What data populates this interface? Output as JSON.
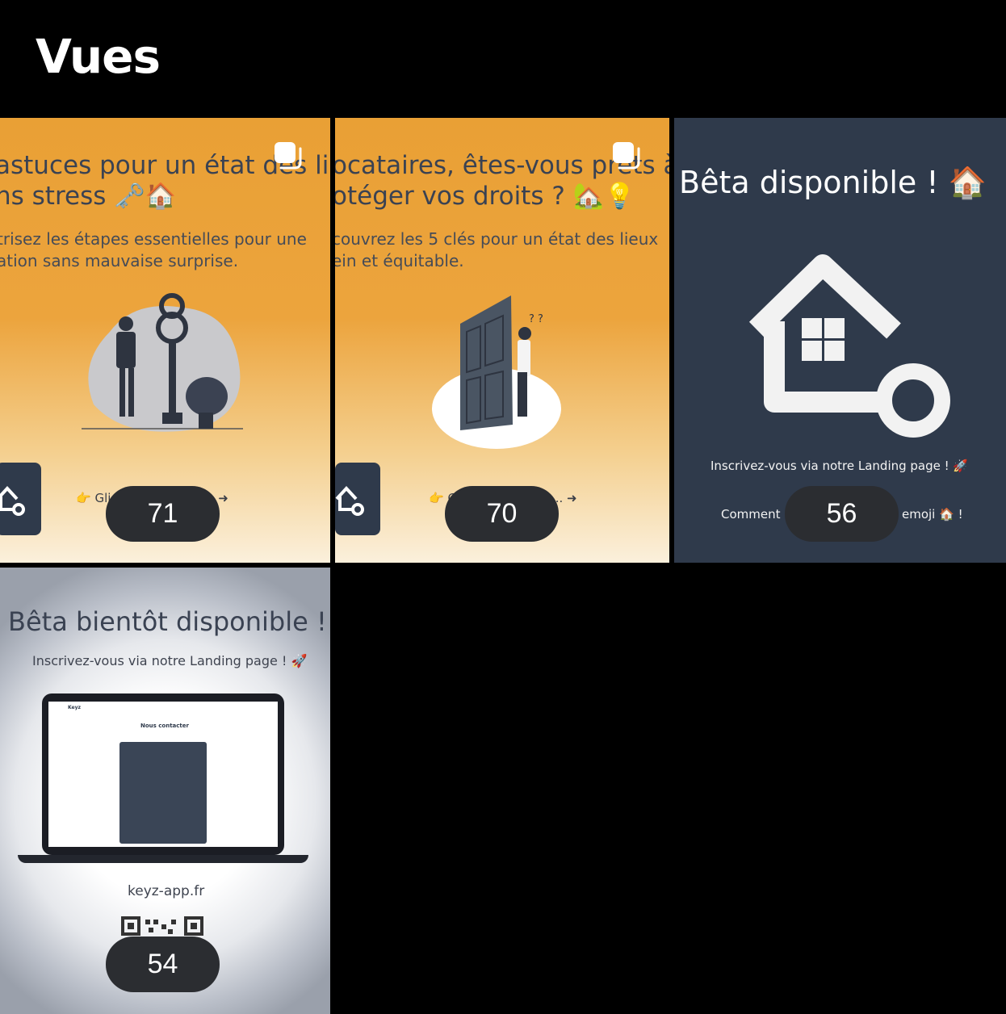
{
  "header": {
    "title": "Vues"
  },
  "tiles": [
    {
      "title_line1": "astuces pour un état des lie",
      "title_line2": "ns stress 🗝️🏠",
      "subtitle_line1": "trisez les étapes essentielles pour une",
      "subtitle_line2": "ation sans mauvaise surprise.",
      "swipe_text": "👉 Gli          rir ces astuces... ➜",
      "views": "71"
    },
    {
      "title_line1": "ocataires, êtes-vous prêts à",
      "title_line2": "otéger vos droits ? 🏡💡",
      "subtitle_line1": "couvrez les 5 clés pour un état des lieux",
      "subtitle_line2": "ein et équitable.",
      "swipe_text": "👉 G          aître vos droits... ➜",
      "views": "70"
    },
    {
      "title": "Bêta disponible ! 🏠",
      "line1": "Inscrivez-vous via notre Landing page ! 🚀",
      "line2_left": "Comment",
      "line2_right": "emoji 🏠 !",
      "views": "56"
    },
    {
      "title": "Bêta bientôt disponible !",
      "subtitle": "Inscrivez-vous via notre Landing page ! 🚀",
      "laptop": {
        "brand": "Keyz",
        "page_title": "Nous contacter"
      },
      "url": "keyz-app.fr",
      "views": "54"
    }
  ],
  "colors": {
    "orange": "#eca43d",
    "navy": "#2f3a4b",
    "badge": "#2b2d31"
  }
}
